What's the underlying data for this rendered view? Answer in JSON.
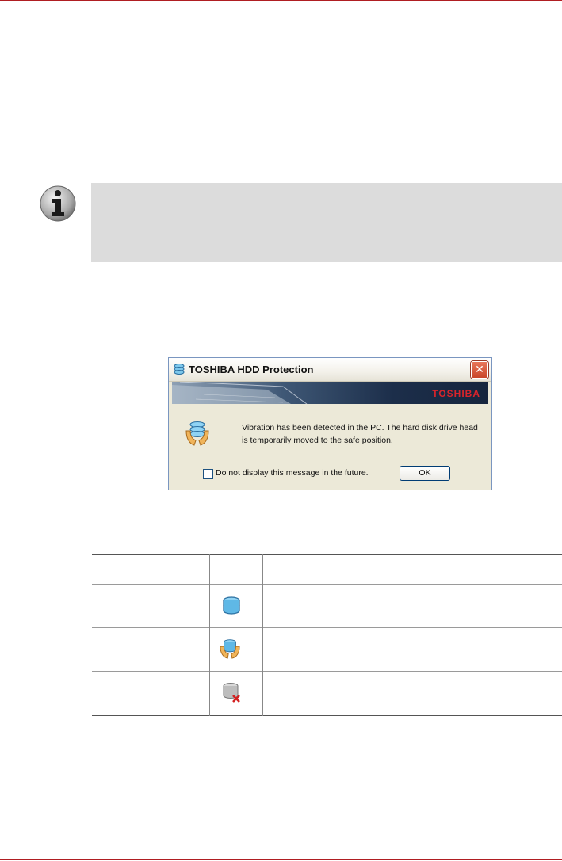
{
  "dialog": {
    "title": "TOSHIBA HDD Protection",
    "banner_brand": "TOSHIBA",
    "close_symbol": "✕",
    "message": "Vibration has been detected in the PC. The hard disk drive head is temporarily moved to the safe position.",
    "checkbox_label": "Do not display this message in the future.",
    "checkbox_checked": false,
    "ok_label": "OK"
  },
  "status_table": {
    "rows": [
      {
        "icon": "hdd-normal-icon"
      },
      {
        "icon": "hdd-protected-icon"
      },
      {
        "icon": "hdd-disabled-icon"
      }
    ]
  },
  "colors": {
    "rule": "#b01e22",
    "note_background": "#dcdcdc",
    "dialog_background": "#ece9d8",
    "brand_red": "#d9242b"
  }
}
